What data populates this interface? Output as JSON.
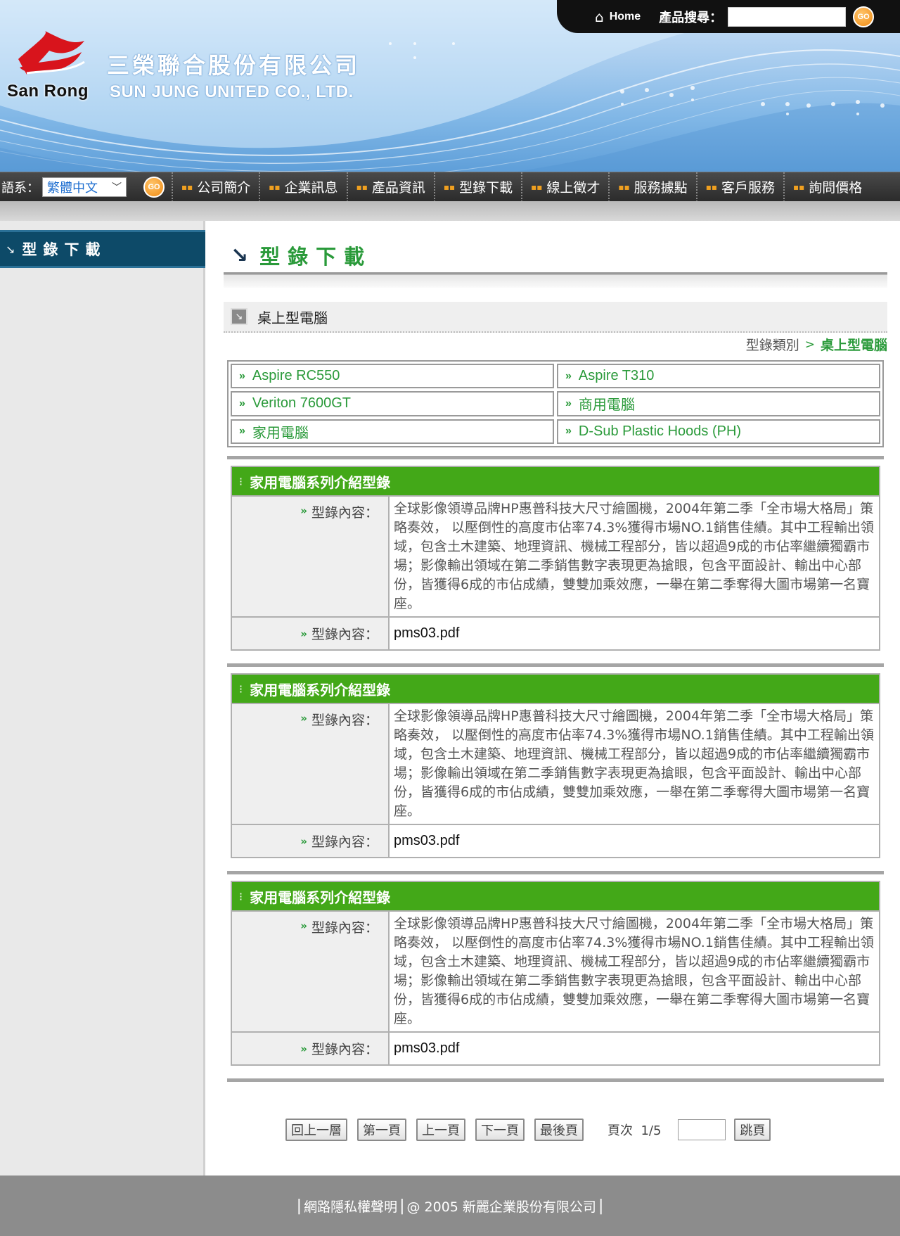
{
  "header": {
    "logo_text": "San Rong",
    "company_cn": "三榮聯合股份有限公司",
    "company_en": "SUN JUNG UNITED CO., LTD.",
    "home_label": "Home",
    "search_label": "產品搜尋：",
    "search_value": "",
    "go_label": "GO"
  },
  "nav": {
    "lang_label": "語系：",
    "lang_value": "繁體中文",
    "go_label": "GO",
    "items": [
      "公司簡介",
      "企業訊息",
      "產品資訊",
      "型錄下載",
      "線上徵才",
      "服務據點",
      "客戶服務",
      "詢問價格"
    ]
  },
  "sidebar": {
    "title": "型錄下載"
  },
  "main": {
    "heading": "型錄下載",
    "category_title": "桌上型電腦",
    "breadcrumb": {
      "parent": "型錄類別",
      "separator": ">",
      "current": "桌上型電腦"
    },
    "links": [
      "Aspire RC550",
      "Aspire T310",
      "Veriton 7600GT",
      "商用電腦",
      "家用電腦",
      "D-Sub Plastic Hoods (PH)"
    ],
    "cards": [
      {
        "title": "家用電腦系列介紹型錄",
        "desc_label": "型錄內容：",
        "desc": "全球影像領導品牌HP惠普科技大尺寸繪圖機，2004年第二季「全市場大格局」策略奏效， 以壓倒性的高度市佔率74.3%獲得市場NO.1銷售佳績。其中工程輸出領域，包含土木建築、地理資訊、機械工程部分，皆以超過9成的市佔率繼續獨霸市場；影像輸出領域在第二季銷售數字表現更為搶眼，包含平面設計、輸出中心部份，皆獲得6成的市佔成績，雙雙加乘效應，一舉在第二季奪得大圖市場第一名寶座。",
        "file_label": "型錄內容：",
        "file": "pms03.pdf"
      },
      {
        "title": "家用電腦系列介紹型錄",
        "desc_label": "型錄內容：",
        "desc": "全球影像領導品牌HP惠普科技大尺寸繪圖機，2004年第二季「全市場大格局」策略奏效， 以壓倒性的高度市佔率74.3%獲得市場NO.1銷售佳績。其中工程輸出領域，包含土木建築、地理資訊、機械工程部分，皆以超過9成的市佔率繼續獨霸市場；影像輸出領域在第二季銷售數字表現更為搶眼，包含平面設計、輸出中心部份，皆獲得6成的市佔成績，雙雙加乘效應，一舉在第二季奪得大圖市場第一名寶座。",
        "file_label": "型錄內容：",
        "file": "pms03.pdf"
      },
      {
        "title": "家用電腦系列介紹型錄",
        "desc_label": "型錄內容：",
        "desc": "全球影像領導品牌HP惠普科技大尺寸繪圖機，2004年第二季「全市場大格局」策略奏效， 以壓倒性的高度市佔率74.3%獲得市場NO.1銷售佳績。其中工程輸出領域，包含土木建築、地理資訊、機械工程部分，皆以超過9成的市佔率繼續獨霸市場；影像輸出領域在第二季銷售數字表現更為搶眼，包含平面設計、輸出中心部份，皆獲得6成的市佔成績，雙雙加乘效應，一舉在第二季奪得大圖市場第一名寶座。",
        "file_label": "型錄內容：",
        "file": "pms03.pdf"
      }
    ]
  },
  "pager": {
    "back": "回上一層",
    "first": "第一頁",
    "prev": "上一頁",
    "next": "下一頁",
    "last": "最後頁",
    "page_label": "頁次",
    "page_value": "1/5",
    "jump_value": "",
    "jump": "跳頁"
  },
  "footer": {
    "privacy": "網路隱私權聲明",
    "copyright": "@ 2005 新麗企業股份有限公司"
  },
  "colors": {
    "accent_green": "#43a818",
    "link_green": "#2a9a3a",
    "sidebar_blue": "#0d4a68",
    "nav_dark": "#2b2b2b",
    "go_orange": "#f08a12"
  },
  "icons": {
    "home": "home-icon",
    "go": "go-button-icon",
    "arrow": "corner-arrow-icon",
    "bullet": "double-chevron-icon"
  }
}
